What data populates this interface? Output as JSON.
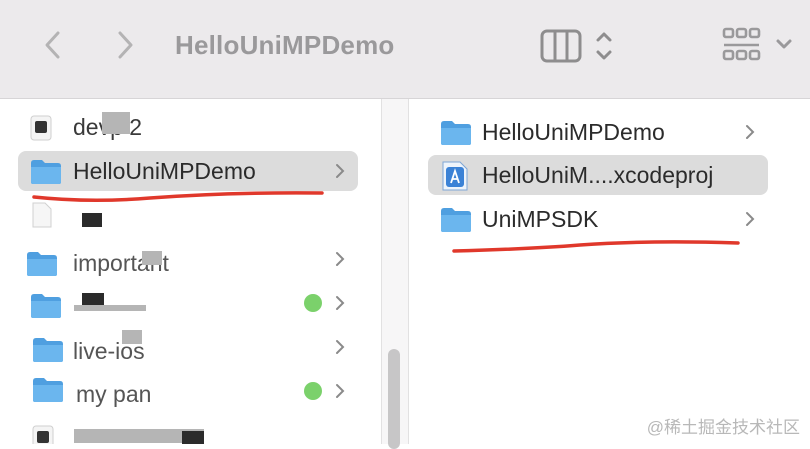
{
  "window": {
    "title": "HelloUniMPDemo"
  },
  "column1": {
    "items": [
      {
        "label": "devp 2",
        "icon": "app-icon"
      },
      {
        "label": "HelloUniMPDemo",
        "icon": "folder-icon",
        "selected": true
      },
      {
        "label": "",
        "icon": "file-icon"
      },
      {
        "label": "important",
        "icon": "folder-icon"
      },
      {
        "label": "",
        "icon": "folder-icon",
        "tag": "green"
      },
      {
        "label": "live-ios",
        "icon": "folder-icon"
      },
      {
        "label": "my pan",
        "icon": "folder-icon",
        "tag": "green"
      },
      {
        "label": "",
        "icon": "app-icon"
      }
    ]
  },
  "column2": {
    "items": [
      {
        "label": "HelloUniMPDemo",
        "icon": "folder-icon"
      },
      {
        "label": "HelloUniM....xcodeproj",
        "icon": "xcodeproj-icon",
        "selected": true
      },
      {
        "label": "UniMPSDK",
        "icon": "folder-icon"
      }
    ]
  },
  "colors": {
    "folder": "#5aa9e6",
    "tag_green": "#7bd16b",
    "annotation_red": "#e0382b"
  },
  "watermark": "@稀土掘金技术社区"
}
